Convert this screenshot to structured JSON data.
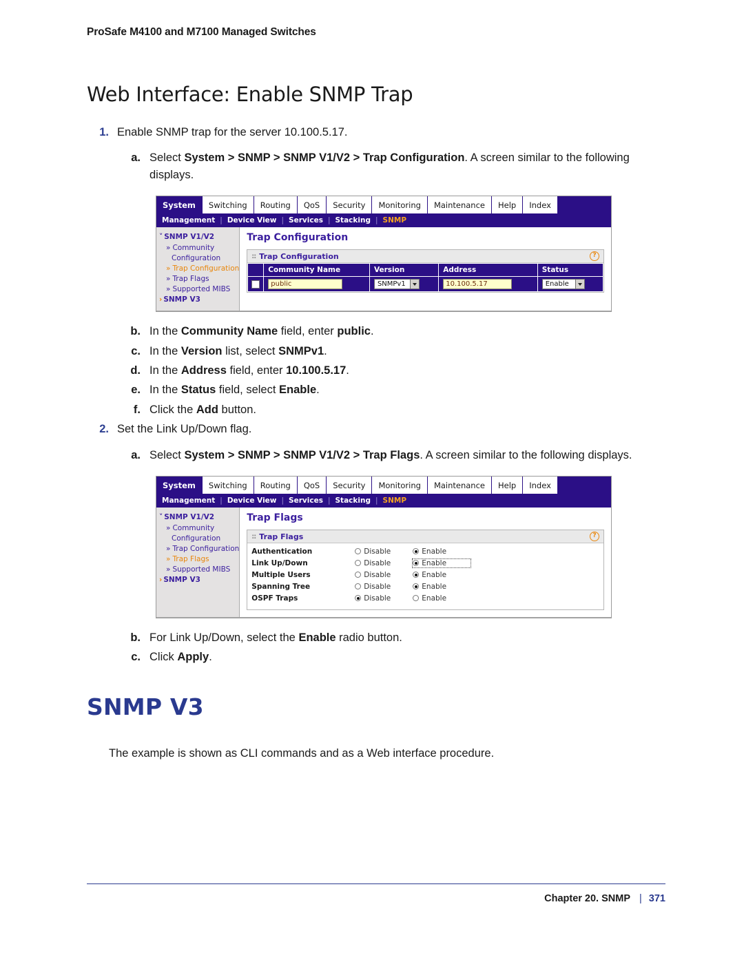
{
  "header": {
    "running_head": "ProSafe M4100 and M7100 Managed Switches"
  },
  "section": {
    "title": "Web Interface: Enable SNMP Trap"
  },
  "steps": [
    {
      "marker": "1.",
      "level": 1,
      "text_html": "Enable SNMP trap for the server 10.100.5.17."
    },
    {
      "marker": "a.",
      "level": 2,
      "text_html": "Select <b>System > SNMP > SNMP V1/V2 > Trap Configuration</b>. A screen similar to the following displays."
    },
    {
      "marker": "b.",
      "level": 2,
      "text_html": "In the <b>Community Name</b> field, enter <b>public</b>."
    },
    {
      "marker": "c.",
      "level": 2,
      "text_html": "In the <b>Version</b> list, select <b>SNMPv1</b>."
    },
    {
      "marker": "d.",
      "level": 2,
      "text_html": "In the <b>Address</b> field, enter <b>10.100.5.17</b>."
    },
    {
      "marker": "e.",
      "level": 2,
      "text_html": "In the <b>Status</b> field, select <b>Enable</b>."
    },
    {
      "marker": "f.",
      "level": 2,
      "text_html": "Click the <b>Add</b> button."
    },
    {
      "marker": "2.",
      "level": 1,
      "text_html": "Set the Link Up/Down flag."
    },
    {
      "marker": "a.",
      "level": 2,
      "text_html": "Select <b>System > SNMP > SNMP V1/V2 > Trap Flags</b>. A screen similar to the following displays."
    },
    {
      "marker": "b.",
      "level": 2,
      "text_html": "For Link Up/Down, select the <b>Enable</b> radio button."
    },
    {
      "marker": "c.",
      "level": 2,
      "text_html": "Click <b>Apply</b>."
    }
  ],
  "sub_heading": "SNMP V3",
  "body_paragraph": "The example is shown as CLI commands and as a Web interface procedure.",
  "figure1": {
    "nav_primary": [
      {
        "label": "System",
        "active": true
      },
      {
        "label": "Switching",
        "active": false
      },
      {
        "label": "Routing",
        "active": false
      },
      {
        "label": "QoS",
        "active": false
      },
      {
        "label": "Security",
        "active": false
      },
      {
        "label": "Monitoring",
        "active": false
      },
      {
        "label": "Maintenance",
        "active": false
      },
      {
        "label": "Help",
        "active": false
      },
      {
        "label": "Index",
        "active": false
      }
    ],
    "nav_secondary": [
      {
        "label": "Management",
        "active": false
      },
      {
        "label": "Device View",
        "active": false
      },
      {
        "label": "Services",
        "active": false
      },
      {
        "label": "Stacking",
        "active": false
      },
      {
        "label": "SNMP",
        "active": true
      }
    ],
    "sidebar": {
      "group1": "SNMP V1/V2",
      "links": [
        {
          "label": "Community",
          "active": false
        },
        {
          "label": "Configuration",
          "active": false
        },
        {
          "label": "Trap Configuration",
          "active": true
        },
        {
          "label": "Trap Flags",
          "active": false
        },
        {
          "label": "Supported MIBS",
          "active": false
        }
      ],
      "group2": "SNMP V3"
    },
    "main_title": "Trap Configuration",
    "panel_title": "Trap Configuration",
    "help_glyph": "?",
    "table": {
      "columns": [
        "",
        "Community Name",
        "Version",
        "Address",
        "Status"
      ],
      "row": {
        "community_name": "public",
        "version": "SNMPv1",
        "address": "10.100.5.17",
        "status": "Enable"
      }
    }
  },
  "figure2": {
    "nav_primary": [
      {
        "label": "System",
        "active": true
      },
      {
        "label": "Switching",
        "active": false
      },
      {
        "label": "Routing",
        "active": false
      },
      {
        "label": "QoS",
        "active": false
      },
      {
        "label": "Security",
        "active": false
      },
      {
        "label": "Monitoring",
        "active": false
      },
      {
        "label": "Maintenance",
        "active": false
      },
      {
        "label": "Help",
        "active": false
      },
      {
        "label": "Index",
        "active": false
      }
    ],
    "nav_secondary": [
      {
        "label": "Management",
        "active": false
      },
      {
        "label": "Device View",
        "active": false
      },
      {
        "label": "Services",
        "active": false
      },
      {
        "label": "Stacking",
        "active": false
      },
      {
        "label": "SNMP",
        "active": true
      }
    ],
    "sidebar": {
      "group1": "SNMP V1/V2",
      "links": [
        {
          "label": "Community",
          "active": false
        },
        {
          "label": "Configuration",
          "active": false
        },
        {
          "label": "Trap Configuration",
          "active": false
        },
        {
          "label": "Trap Flags",
          "active": true
        },
        {
          "label": "Supported MIBS",
          "active": false
        }
      ],
      "group2": "SNMP V3"
    },
    "main_title": "Trap Flags",
    "panel_title": "Trap Flags",
    "help_glyph": "?",
    "option_labels": {
      "disable": "Disable",
      "enable": "Enable"
    },
    "flags": [
      {
        "label": "Authentication",
        "selected": "enable",
        "focused": false
      },
      {
        "label": "Link Up/Down",
        "selected": "enable",
        "focused": true
      },
      {
        "label": "Multiple Users",
        "selected": "enable",
        "focused": false
      },
      {
        "label": "Spanning Tree",
        "selected": "enable",
        "focused": false
      },
      {
        "label": "OSPF Traps",
        "selected": "disable",
        "focused": false
      }
    ]
  },
  "footer": {
    "chapter": "Chapter 20. SNMP",
    "divider": "|",
    "page_number": "371"
  },
  "colors": {
    "nav_purple": "#2b0f86",
    "accent_orange": "#e8860c",
    "heading_blue": "#2a3a8f",
    "input_yellow": "#ffffcc",
    "sidebar_gray": "#e4e2e2"
  }
}
